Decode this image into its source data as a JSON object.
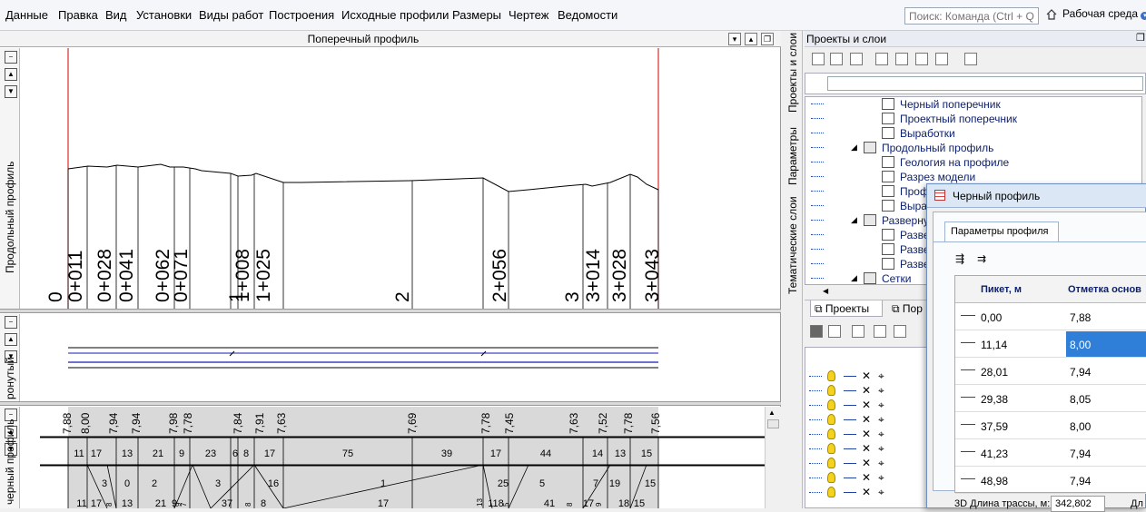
{
  "menu": [
    "Данные",
    "Правка",
    "Вид",
    "Установки",
    "Виды работ",
    "Построения",
    "Исходные профили",
    "Размеры",
    "Чертеж",
    "Ведомости"
  ],
  "search": {
    "placeholder": "Поиск: Команда (Ctrl + Q)"
  },
  "workspace": {
    "label": "Рабочая среда"
  },
  "left_window": {
    "title": "Поперечный профиль",
    "side_tabs": [
      "Продольный профиль",
      "ронутый",
      "черный профиль"
    ]
  },
  "profile": {
    "pikets": [
      "0",
      "0+011",
      "0+028",
      "0+041",
      "0+062",
      "0+071",
      "1",
      "1+008",
      "1+025",
      "2",
      "2+056",
      "3",
      "3+014",
      "3+028",
      "3+043"
    ],
    "elevations": [
      "7,88",
      "8,00",
      "7,94",
      "7,94",
      "7,98",
      "7,78",
      "7,84",
      "7,91",
      "7,63",
      "7,69",
      "7,78",
      "7,45",
      "7,63",
      "7,52",
      "7,78",
      "7,56"
    ],
    "row1": [
      "11",
      "17",
      "13",
      "21",
      "9",
      "23",
      "6",
      "8",
      "17",
      "75",
      "39",
      "17",
      "44",
      "14",
      "13",
      "15"
    ],
    "row2": [
      "3",
      "0",
      "2",
      "3",
      "16",
      "1",
      "25",
      "5",
      "7",
      "19",
      "15"
    ],
    "row3": [
      "11",
      "17",
      "13",
      "21",
      "9",
      "37",
      "8",
      "17",
      "118",
      "41",
      "17",
      "18",
      "15"
    ],
    "row3_small": [
      "8",
      "9",
      "7",
      "8",
      "13",
      "5",
      "8",
      "9"
    ]
  },
  "right_panel": {
    "title": "Проекты и слои",
    "side_tabs": [
      "Проекты и слои",
      "Параметры",
      "Тематические слои"
    ],
    "tree": [
      {
        "label": "Черный поперечник",
        "indent": 2
      },
      {
        "label": "Проектный поперечник",
        "indent": 2
      },
      {
        "label": "Выработки",
        "indent": 2
      },
      {
        "label": "Продольный профиль",
        "indent": 1,
        "expander": "◢"
      },
      {
        "label": "Геология на профиле",
        "indent": 2
      },
      {
        "label": "Разрез модели",
        "indent": 2
      },
      {
        "label": "Проф",
        "indent": 2
      },
      {
        "label": "Выра",
        "indent": 2
      },
      {
        "label": "Развернуг",
        "indent": 1,
        "expander": "◢"
      },
      {
        "label": "Разве",
        "indent": 2
      },
      {
        "label": "Разве",
        "indent": 2
      },
      {
        "label": "Разве",
        "indent": 2
      },
      {
        "label": "Сетки",
        "indent": 1,
        "expander": "◢"
      }
    ],
    "bottom_tabs": [
      "Проекты",
      "Пор"
    ]
  },
  "dialog": {
    "title": "Черный профиль",
    "tab": "Параметры профиля",
    "columns": [
      "Пикет, м",
      "Отметка основ"
    ],
    "rows": [
      [
        "0,00",
        "7,88"
      ],
      [
        "11,14",
        "8,00"
      ],
      [
        "28,01",
        "7,94"
      ],
      [
        "29,38",
        "8,05"
      ],
      [
        "37,59",
        "8,00"
      ],
      [
        "41,23",
        "7,94"
      ],
      [
        "48,98",
        "7,94"
      ]
    ],
    "selected_row": 1,
    "footer_label": "3D Длина трассы, м:",
    "footer_value": "342,802",
    "footer_trail": "Дл"
  },
  "colors": {
    "accent": "#2f7fd8",
    "redline": "#d00000"
  }
}
